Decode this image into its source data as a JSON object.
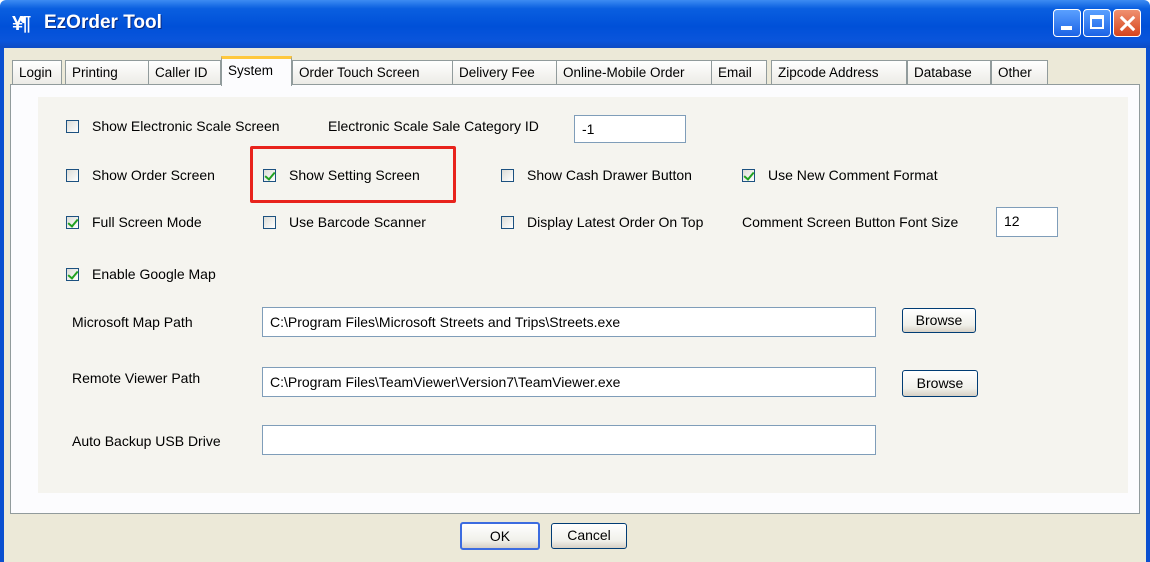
{
  "window": {
    "title": "EzOrder Tool",
    "icon": "fork-knife-icon"
  },
  "tabs": [
    {
      "label": "Login"
    },
    {
      "label": "Printing"
    },
    {
      "label": "Caller ID"
    },
    {
      "label": "System",
      "active": true
    },
    {
      "label": "Order Touch Screen"
    },
    {
      "label": "Delivery Fee"
    },
    {
      "label": "Online-Mobile Order"
    },
    {
      "label": "Email"
    },
    {
      "label": "Zipcode Address"
    },
    {
      "label": "Database"
    },
    {
      "label": "Other"
    }
  ],
  "system": {
    "show_electronic_scale_screen": {
      "label": "Show Electronic Scale Screen",
      "checked": false
    },
    "electronic_scale_category": {
      "label": "Electronic Scale Sale Category ID",
      "value": "-1"
    },
    "show_order_screen": {
      "label": "Show Order Screen",
      "checked": false
    },
    "show_setting_screen": {
      "label": "Show Setting Screen",
      "checked": true
    },
    "show_cash_drawer_button": {
      "label": "Show Cash Drawer Button",
      "checked": false
    },
    "use_new_comment_format": {
      "label": "Use New Comment Format",
      "checked": true
    },
    "full_screen_mode": {
      "label": "Full Screen Mode",
      "checked": true
    },
    "use_barcode_scanner": {
      "label": "Use Barcode Scanner",
      "checked": false
    },
    "display_latest_order_on_top": {
      "label": "Display Latest Order On Top",
      "checked": false
    },
    "comment_font_size": {
      "label": "Comment Screen Button Font Size",
      "value": "12"
    },
    "enable_google_map": {
      "label": "Enable Google Map",
      "checked": true
    },
    "microsoft_map_path": {
      "label": "Microsoft Map Path",
      "value": "C:\\Program Files\\Microsoft Streets and Trips\\Streets.exe",
      "browse": "Browse"
    },
    "remote_viewer_path": {
      "label": "Remote Viewer Path",
      "value": "C:\\Program Files\\TeamViewer\\Version7\\TeamViewer.exe",
      "browse": "Browse"
    },
    "auto_backup_usb": {
      "label": "Auto Backup USB Drive",
      "value": ""
    }
  },
  "footer": {
    "ok": "OK",
    "cancel": "Cancel"
  },
  "colors": {
    "titlebar": "#0050d8",
    "highlight": "#e8231c",
    "check": "#21a121"
  }
}
